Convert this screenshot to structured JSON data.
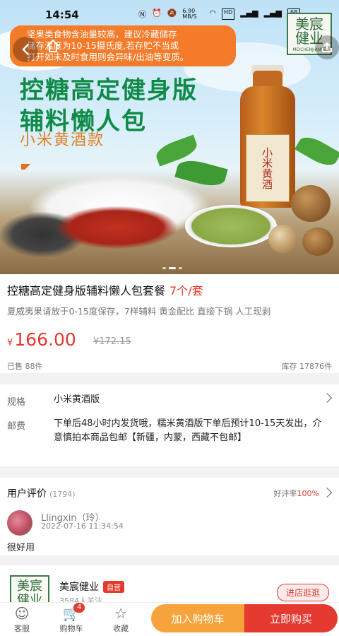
{
  "status_bar": {
    "time": "14:54",
    "net_speed": "6.90 MB/S",
    "icons": [
      "nfc-icon",
      "alarm-icon",
      "mute-icon",
      "wifi-icon",
      "hd-icon",
      "signal-4g-icon",
      "signal-5g-icon",
      "battery-icon"
    ],
    "battery": "68"
  },
  "notice": {
    "lines": [
      "坚果类食物含油量较高，建议冷藏储存",
      "储存温度为10-15摄氏度,若存贮不当或",
      "打开如未及时食用则会异味/出油等变质。"
    ]
  },
  "banner": {
    "headline1": "控糖高定健身版",
    "headline2": "辅料懒人包",
    "headline3": "小米黄酒款",
    "bottle_label": "小米黄酒",
    "brand_logo": "美宸健业",
    "brand_logo_sub": "MEICHENJIANYE"
  },
  "product": {
    "title": "控糖高定健身版辅料懒人包套餐",
    "unit": "7个/套",
    "subtitle": "夏威夷果请放于0-15度保存，7样辅料 黄金配比 直接下锅 人工现剥",
    "price_symbol": "¥",
    "price": "166.00",
    "old_price": "¥172.15",
    "sold": "已售 88件",
    "stock": "库存 17876件"
  },
  "spec": {
    "spec_label": "规格",
    "spec_value": "小米黄酒版",
    "shipping_label": "邮费",
    "shipping_value": "下单后48小时内发货哦，糯米黄酒版下单后预计10-15天发出，介意慎拍本商品包邮【新疆，内蒙，西藏不包邮】"
  },
  "review": {
    "title": "用户评价",
    "count": "(1794)",
    "rate_label": "好评率",
    "rate_value": "100%",
    "reviewer": "Llingxin（玲）",
    "date": "2022-07-16 11:34:54",
    "text": "很好用"
  },
  "store": {
    "logo_text": "美宸健业",
    "name": "美宸健业",
    "tag": "自营",
    "follow": "3584人关注",
    "button": "进店逛逛"
  },
  "bottom_bar": {
    "service": "客服",
    "cart": "购物车",
    "cart_badge": "4",
    "favorite": "收藏",
    "add_to_cart": "加入购物车",
    "buy_now": "立即购买"
  },
  "colors": {
    "accent_red": "#e33b2d",
    "orange": "#f5a33a",
    "brand_green": "#0f8a47"
  }
}
